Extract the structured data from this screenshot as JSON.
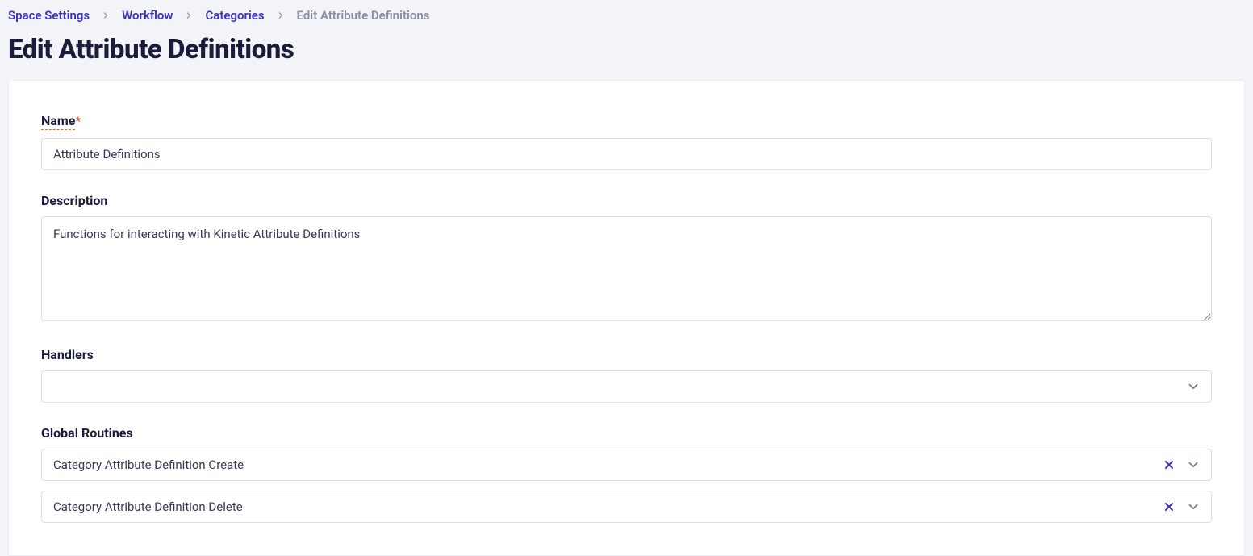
{
  "breadcrumb": {
    "items": [
      "Space Settings",
      "Workflow",
      "Categories"
    ],
    "current": "Edit Attribute Definitions"
  },
  "title": "Edit Attribute Definitions",
  "form": {
    "name": {
      "label": "Name",
      "required_marker": "*",
      "value": "Attribute Definitions"
    },
    "description": {
      "label": "Description",
      "value": "Functions for interacting with Kinetic Attribute Definitions"
    },
    "handlers": {
      "label": "Handlers",
      "value": ""
    },
    "global_routines": {
      "label": "Global Routines",
      "items": [
        "Category Attribute Definition Create",
        "Category Attribute Definition Delete"
      ]
    }
  }
}
